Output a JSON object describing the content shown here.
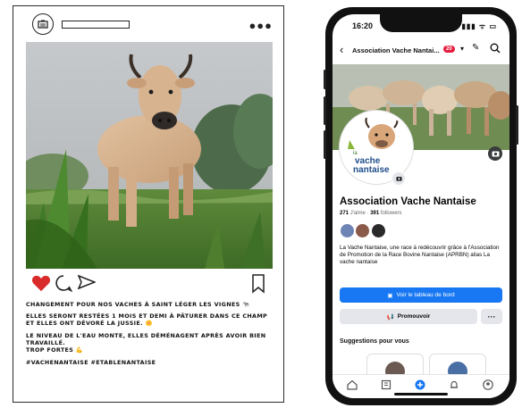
{
  "instagram": {
    "caption": {
      "line1": "CHANGEMENT POUR NOS VACHES À SAINT LÉGER LES VIGNES 🐄",
      "line2": "ELLES SERONT RESTÉES 1 MOIS ET DEMI À PÂTURER DANS CE CHAMP ET ELLES ONT DÉVORÉ LA JUSSIE. 🌼",
      "line3": "LE NIVEAU DE L'EAU MONTE, ELLES DÉMÉNAGENT APRÈS AVOIR BIEN TRAVAILLÉ.",
      "line4": "TROP FORTES 💪",
      "hashtags": "#VACHENANTAISE #ETABLENANTAISE"
    },
    "icons": [
      "camera-icon",
      "more-icon",
      "heart-icon",
      "comment-icon",
      "share-icon",
      "bookmark-icon"
    ]
  },
  "phone": {
    "status_time": "16:20",
    "status_right": "▮▮▮ ᯤ ▭",
    "header_title": "Association Vache Nantai...",
    "header_badge": "20",
    "profile_logo_top": "la",
    "profile_logo_name": "vache",
    "profile_logo_name2": "nantaise",
    "page_name": "Association Vache Nantaise",
    "likes": "271",
    "likes_label": "J'aime",
    "followers": "391",
    "followers_label": "followers",
    "about": "La Vache Nantaise, une race à redécouvrir grâce à l'Association de Promotion de la Race Bovine Nantaise (APRBN) alias La vache nantaise",
    "primary_button": "Voir le tableau de bord",
    "secondary_button": "Promouvoir",
    "more_button": "···",
    "suggestions_title": "Suggestions pour vous"
  },
  "colors": {
    "fb_blue": "#1877f2",
    "heart_red": "#d92b2b"
  }
}
